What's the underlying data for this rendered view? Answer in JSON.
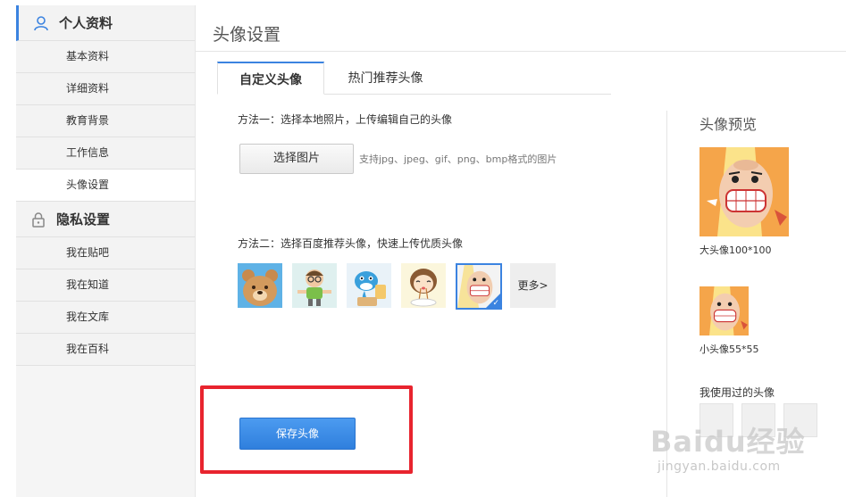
{
  "sidebar": {
    "sections": [
      {
        "title": "个人资料",
        "icon": "person-icon",
        "items": [
          "基本资料",
          "详细资料",
          "教育背景",
          "工作信息",
          "头像设置"
        ]
      },
      {
        "title": "隐私设置",
        "icon": "lock-icon",
        "items": [
          "我在贴吧",
          "我在知道",
          "我在文库",
          "我在百科"
        ]
      }
    ],
    "current_item": "头像设置"
  },
  "main": {
    "title": "头像设置",
    "tabs": [
      {
        "label": "自定义头像",
        "active": true
      },
      {
        "label": "热门推荐头像",
        "active": false
      }
    ],
    "method1": {
      "text": "方法一：选择本地照片，上传编辑自己的头像",
      "button": "选择图片",
      "hint": "支持jpg、jpeg、gif、png、bmp格式的图片"
    },
    "method2": {
      "text": "方法二：选择百度推荐头像，快速上传优质头像",
      "avatars": [
        "bear-avatar",
        "boy-glasses-avatar",
        "blue-dolphin-avatar",
        "girl-eating-avatar",
        "bald-man-avatar"
      ],
      "selected_index": 4,
      "more_label": "更多>"
    },
    "save_button": "保存头像"
  },
  "preview": {
    "title": "头像预览",
    "big_caption": "大头像100*100",
    "small_caption": "小头像55*55",
    "used_title": "我使用过的头像"
  },
  "watermark": {
    "brand": "Baidu经验",
    "url": "jingyan.baidu.com"
  },
  "colors": {
    "accent": "#3b83e0",
    "highlight_box": "#e8242e",
    "save_button": "#3a89e6"
  }
}
